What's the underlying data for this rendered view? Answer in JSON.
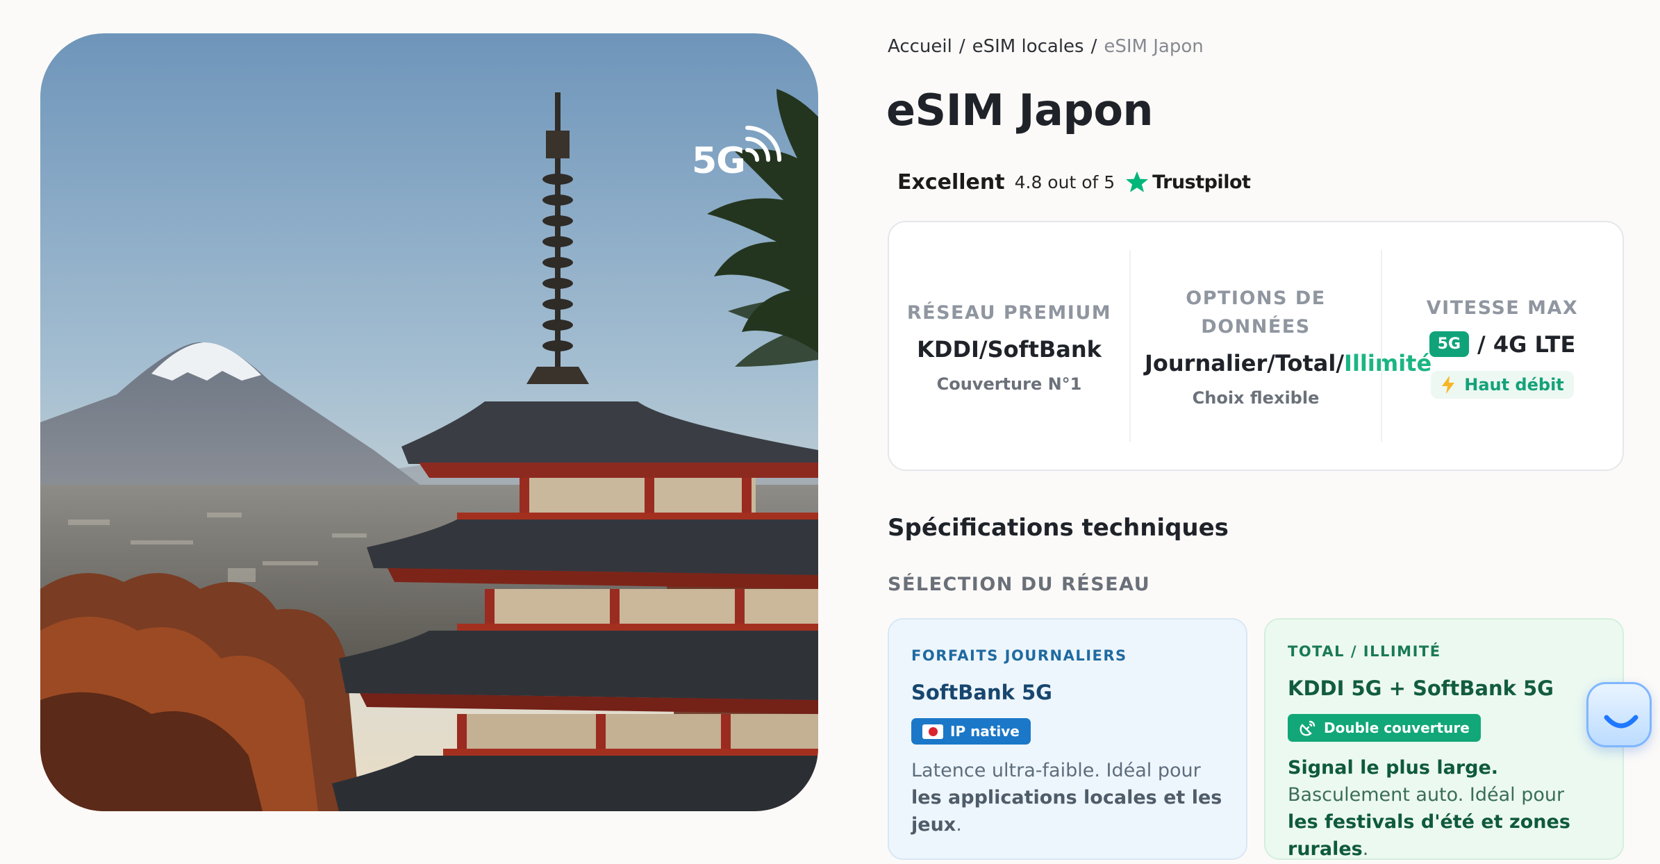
{
  "hero": {
    "network_badge": "5G"
  },
  "breadcrumb": {
    "items": [
      "Accueil",
      "eSIM locales"
    ],
    "separator": "/",
    "current": "eSIM Japon"
  },
  "page_title": "eSIM Japon",
  "rating": {
    "label": "Excellent",
    "score_text": "4.8 out of 5",
    "provider": "Trustpilot",
    "star_icon": "star-icon"
  },
  "stats": [
    {
      "label": "RÉSEAU PREMIUM",
      "value": "KDDI/SoftBank",
      "sub": "Couverture N°1"
    },
    {
      "label": "OPTIONS DE DONNÉES",
      "value_prefix": "Journalier/Total/",
      "value_highlight": "Illimité",
      "sub": "Choix flexible"
    },
    {
      "label": "VITESSE MAX",
      "badge": "5G",
      "value": "/ 4G LTE",
      "sub": "Haut débit",
      "sub_icon": "lightning-icon"
    }
  ],
  "specs": {
    "title": "Spécifications techniques",
    "subtitle": "SÉLECTION DU RÉSEAU"
  },
  "cards": [
    {
      "kicker": "FORFAITS JOURNALIERS",
      "network": "SoftBank 5G",
      "tag": "IP native",
      "tag_icon": "japan-flag-icon",
      "desc_1": "Latence ultra-faible. Idéal pour ",
      "desc_bold": "les applications locales et les jeux",
      "desc_2": "."
    },
    {
      "kicker": "TOTAL / ILLIMITÉ",
      "network": "KDDI 5G + SoftBank 5G",
      "tag": "Double couverture",
      "tag_icon": "satellite-icon",
      "desc_bold_1": "Signal le plus large.",
      "desc_1": " Basculement auto. Idéal pour ",
      "desc_bold_2": "les festivals d'été et zones rurales",
      "desc_2": "."
    }
  ],
  "colors": {
    "accent_green": "#1bb583",
    "badge_green": "#10a37a",
    "blue_tag": "#1b78c8",
    "trustpilot_star": "#00b67a"
  }
}
